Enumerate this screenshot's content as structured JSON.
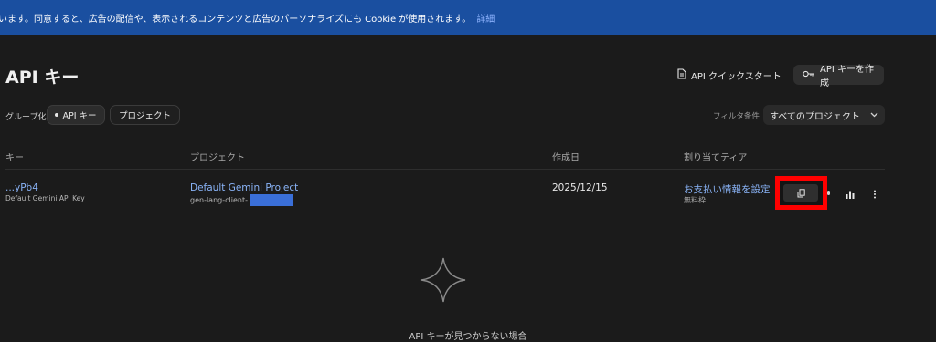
{
  "banner": {
    "text": "います。同意すると、広告の配信や、表示されるコンテンツと広告のパーソナライズにも Cookie が使用されます。",
    "link": "詳細"
  },
  "header": {
    "title": "API キー",
    "quickstart_label": "API クイックスタート",
    "create_label": "API キーを作成"
  },
  "grouping": {
    "label": "グループ化",
    "options": [
      "API キー",
      "プロジェクト"
    ],
    "selected": "API キー"
  },
  "filter": {
    "label": "フィルタ条件",
    "value": "すべてのプロジェクト"
  },
  "table": {
    "columns": [
      "キー",
      "プロジェクト",
      "作成日",
      "割り当てティア"
    ],
    "rows": [
      {
        "key": "...yPb4",
        "key_name": "Default Gemini API Key",
        "project": "Default Gemini Project",
        "project_id": "gen-lang-client-",
        "created": "2025/12/15",
        "tier_action": "お支払い情報を設定",
        "tier": "無料枠"
      }
    ]
  },
  "empty_state": {
    "title": "API キーが見つからない場合"
  },
  "colors": {
    "accent_link": "#8ab4f8",
    "banner_bg": "#1a4fa0",
    "highlight": "#ff0000"
  }
}
